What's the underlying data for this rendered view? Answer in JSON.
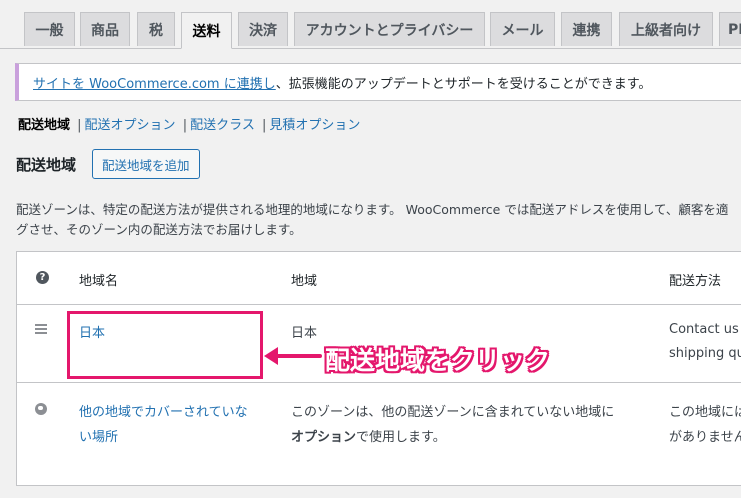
{
  "tabs": [
    {
      "label": "一般"
    },
    {
      "label": "商品"
    },
    {
      "label": "税"
    },
    {
      "label": "送料"
    },
    {
      "label": "決済"
    },
    {
      "label": "アカウントとプライバシー"
    },
    {
      "label": "メール"
    },
    {
      "label": "連携"
    },
    {
      "label": "上級者向け"
    },
    {
      "label": "PD"
    }
  ],
  "notice": {
    "link": "サイトを WooCommerce.com に連携し",
    "text": "、拡張機能のアップデートとサポートを受けることができます。"
  },
  "subnav": {
    "current": "配送地域",
    "links": [
      "配送オプション",
      "配送クラス",
      "見積オプション"
    ],
    "sep": "|"
  },
  "heading": "配送地域",
  "add_button": "配送地域を追加",
  "description": [
    "配送ゾーンは、特定の配送方法が提供される地理的地域になります。 WooCommerce では配送アドレスを使用して、顧客を適",
    "グさせ、そのゾーン内の配送方法でお届けします。"
  ],
  "table": {
    "help_icon": "?",
    "headers": {
      "name": "地域名",
      "region": "地域",
      "methods": "配送方法"
    },
    "rows": [
      {
        "name": "日本",
        "region": "日本",
        "methods_1": "Contact us to",
        "methods_2": "shipping quo"
      },
      {
        "name_1": "他の地域でカバーされていな",
        "name_2": "い場所",
        "region_1": "このゾーンは、他の配送ゾーンに含まれていない地域に",
        "region_2_bold": "オプション",
        "region_2_rest": "で使用します。",
        "methods_1": "この地域には",
        "methods_2": "がありません"
      }
    ]
  },
  "annotation": {
    "text": "配送地域をクリック",
    "color": "#e4176c"
  }
}
